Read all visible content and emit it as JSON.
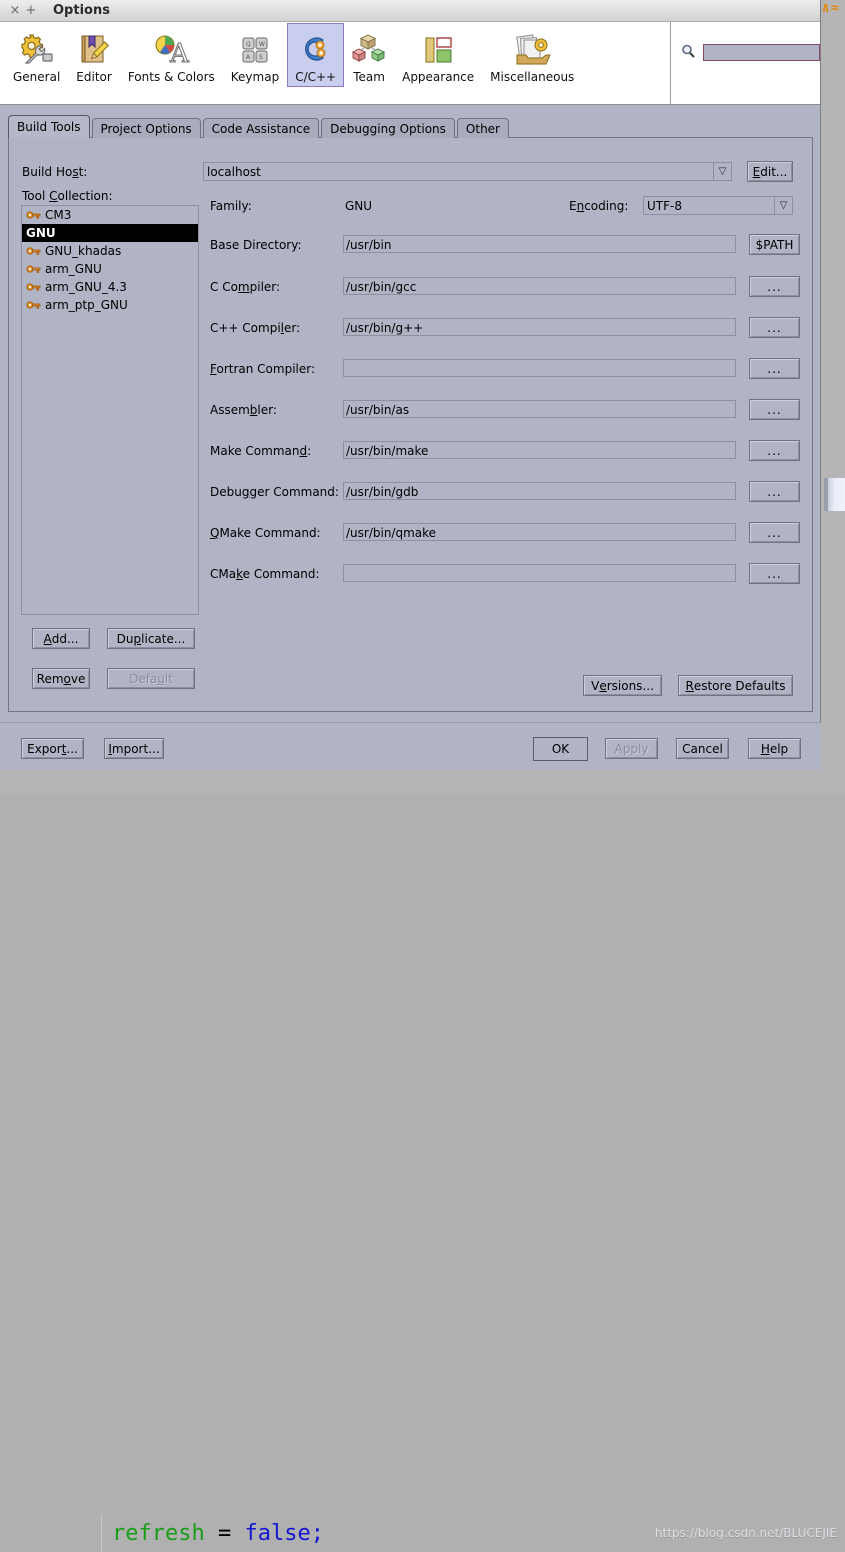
{
  "window": {
    "title": "Options",
    "close_glyph": "×",
    "add_glyph": "+"
  },
  "categories": [
    {
      "label": "General",
      "icon": "gear-wrench-icon",
      "selected": false
    },
    {
      "label": "Editor",
      "icon": "book-pencil-icon",
      "selected": false
    },
    {
      "label": "Fonts & Colors",
      "icon": "font-palette-icon",
      "selected": false
    },
    {
      "label": "Keymap",
      "icon": "keyboard-keys-icon",
      "selected": false
    },
    {
      "label": "C/C++",
      "icon": "c-plus-plus-icon",
      "selected": true
    },
    {
      "label": "Team",
      "icon": "cubes-icon",
      "selected": false
    },
    {
      "label": "Appearance",
      "icon": "layout-panels-icon",
      "selected": false
    },
    {
      "label": "Miscellaneous",
      "icon": "documents-gear-icon",
      "selected": false
    }
  ],
  "search": {
    "icon": "search-icon",
    "value": "",
    "placeholder": ""
  },
  "tabs": [
    {
      "label": "Build Tools",
      "active": true
    },
    {
      "label": "Project Options",
      "active": false
    },
    {
      "label": "Code Assistance",
      "active": false
    },
    {
      "label": "Debugging Options",
      "active": false
    },
    {
      "label": "Other",
      "active": false
    }
  ],
  "build_host": {
    "label_pre": "Build Ho",
    "label_mnemonic": "s",
    "label_post": "t:",
    "value": "localhost",
    "edit_button": {
      "pre": "",
      "mnemonic": "E",
      "post": "dit..."
    }
  },
  "tool_collection": {
    "label_pre": "Tool ",
    "label_mnemonic": "C",
    "label_post": "ollection:",
    "items": [
      {
        "label": "CM3",
        "selected": false,
        "icon": "key-icon"
      },
      {
        "label": "GNU",
        "selected": true,
        "icon": "key-icon"
      },
      {
        "label": "GNU_khadas",
        "selected": false,
        "icon": "key-icon"
      },
      {
        "label": "arm_GNU",
        "selected": false,
        "icon": "key-icon"
      },
      {
        "label": "arm_GNU_4.3",
        "selected": false,
        "icon": "key-icon"
      },
      {
        "label": "arm_ptp_GNU",
        "selected": false,
        "icon": "key-icon"
      }
    ],
    "buttons": [
      {
        "name": "add",
        "pre": "",
        "mnemonic": "A",
        "post": "dd...",
        "disabled": false
      },
      {
        "name": "duplicate",
        "pre": "Du",
        "mnemonic": "p",
        "post": "licate...",
        "disabled": false
      },
      {
        "name": "remove",
        "pre": "Rem",
        "mnemonic": "o",
        "post": "ve",
        "disabled": false
      },
      {
        "name": "default",
        "pre": "Defa",
        "mnemonic": "u",
        "post": "lt",
        "disabled": true
      }
    ]
  },
  "family": {
    "label": "Family:",
    "value": "GNU"
  },
  "encoding": {
    "label_pre": "E",
    "label_mnemonic": "n",
    "label_post": "coding:",
    "value": "UTF-8"
  },
  "fields": [
    {
      "name": "base-directory",
      "pre": "Base Directory:",
      "mnemonic": "",
      "post": "",
      "value": "/usr/bin",
      "button": "$PATH"
    },
    {
      "name": "c-compiler",
      "pre": "C Co",
      "mnemonic": "m",
      "post": "piler:",
      "value": "/usr/bin/gcc",
      "button": "..."
    },
    {
      "name": "cpp-compiler",
      "pre": "C++ Compi",
      "mnemonic": "l",
      "post": "er:",
      "value": "/usr/bin/g++",
      "button": "..."
    },
    {
      "name": "fortran-compiler",
      "pre": "",
      "mnemonic": "F",
      "post": "ortran Compiler:",
      "value": "",
      "button": "..."
    },
    {
      "name": "assembler",
      "pre": "Assem",
      "mnemonic": "b",
      "post": "ler:",
      "value": "/usr/bin/as",
      "button": "..."
    },
    {
      "name": "make-command",
      "pre": "Make Comman",
      "mnemonic": "d",
      "post": ":",
      "value": "/usr/bin/make",
      "button": "..."
    },
    {
      "name": "debugger-command",
      "pre": "Debu",
      "mnemonic": "g",
      "post": "ger Command:",
      "value": "/usr/bin/gdb",
      "button": "..."
    },
    {
      "name": "qmake-command",
      "pre": "",
      "mnemonic": "Q",
      "post": "Make Command:",
      "value": "/usr/bin/qmake",
      "button": "..."
    },
    {
      "name": "cmake-command",
      "pre": "CMa",
      "mnemonic": "k",
      "post": "e Command:",
      "value": "",
      "button": "..."
    }
  ],
  "panel_buttons": [
    {
      "name": "versions",
      "pre": "V",
      "mnemonic": "e",
      "post": "rsions..."
    },
    {
      "name": "restore-defaults",
      "pre": "",
      "mnemonic": "R",
      "post": "estore Defaults"
    }
  ],
  "dialog_buttons": {
    "left": [
      {
        "name": "export",
        "pre": "Expor",
        "mnemonic": "t",
        "post": "...",
        "disabled": false
      },
      {
        "name": "import",
        "pre": "",
        "mnemonic": "I",
        "post": "mport...",
        "disabled": false
      }
    ],
    "right": [
      {
        "name": "ok",
        "pre": "OK",
        "mnemonic": "",
        "post": "",
        "disabled": false,
        "default": true
      },
      {
        "name": "apply",
        "pre": "Apply",
        "mnemonic": "",
        "post": "",
        "disabled": true,
        "default": false
      },
      {
        "name": "cancel",
        "pre": "Cancel",
        "mnemonic": "",
        "post": "",
        "disabled": false,
        "default": false
      },
      {
        "name": "help",
        "pre": "",
        "mnemonic": "H",
        "post": "elp",
        "disabled": false,
        "default": false
      }
    ]
  },
  "background": {
    "code_ident": "refresh",
    "code_op": "=",
    "code_kw": "false;",
    "orange_text": "↑∧≈",
    "watermark": "https://blog.csdn.net/BLUCEJIE"
  },
  "colors": {
    "dialog_bg": "#b0b4c4",
    "selection_bg": "#000000",
    "selection_fg": "#ffffff",
    "tab_selected": "#c9cdee",
    "tab_selected_border": "#8f78c0",
    "search_border": "#8a4a63",
    "key_icon": "#e08a30",
    "code_ident": "#1a9e1a",
    "code_keyword": "#1414d2"
  }
}
